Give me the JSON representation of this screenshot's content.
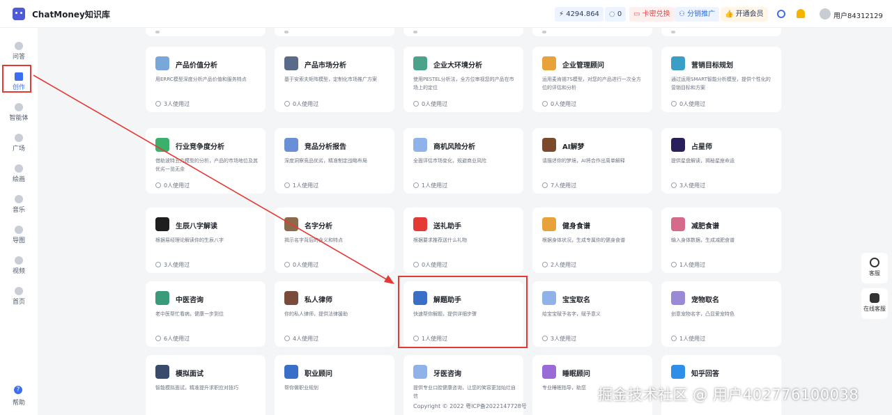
{
  "header": {
    "app_title": "ChatMoney知识库",
    "balance": "4294.864",
    "count": "0",
    "redeem_label": "卡密兑换",
    "promo_label": "分销推广",
    "vip_label": "开通会员",
    "user_name": "用户84312129"
  },
  "sidebar": {
    "items": [
      {
        "label": "问答",
        "icon": "chat-icon"
      },
      {
        "label": "创作",
        "icon": "pen-icon"
      },
      {
        "label": "智能体",
        "icon": "robot-icon"
      },
      {
        "label": "广场",
        "icon": "grid-icon"
      },
      {
        "label": "绘画",
        "icon": "palette-icon"
      },
      {
        "label": "音乐",
        "icon": "music-icon"
      },
      {
        "label": "导图",
        "icon": "mindmap-icon"
      },
      {
        "label": "视频",
        "icon": "video-icon"
      },
      {
        "label": "首页",
        "icon": "home-icon"
      }
    ],
    "help_label": "帮助"
  },
  "cards": [
    {
      "title": "产品价值分析",
      "desc": "用ERRC模型深度分析产品价值和服务特点",
      "usage": "3人使用过",
      "color": "#7aa7d9"
    },
    {
      "title": "产品市场分析",
      "desc": "基于安索夫矩阵模型，定制化市场推广方案",
      "usage": "0人使用过",
      "color": "#5a6b8a"
    },
    {
      "title": "企业大环境分析",
      "desc": "使用PESTEL分析法，全方位审视您的产品在市场上的定位",
      "usage": "0人使用过",
      "color": "#4aa38a"
    },
    {
      "title": "企业管理顾问",
      "desc": "运用麦肯锡7S模型，对您的产品进行一次全方位的评估和分析",
      "usage": "0人使用过",
      "color": "#e8a23a"
    },
    {
      "title": "营销目标规划",
      "desc": "通过运用SMART智能分析模型，提供个性化的营销目标和方案",
      "usage": "0人使用过",
      "color": "#3a9fc7"
    },
    {
      "title": "行业竞争度分析",
      "desc": "借助波特五力模型的分析，产品的市场地位及其优劣一览无余",
      "usage": "0人使用过",
      "color": "#3ab06a"
    },
    {
      "title": "竞品分析报告",
      "desc": "深度洞察竞品优劣，精准制定战略布局",
      "usage": "1人使用过",
      "color": "#6b8fd6"
    },
    {
      "title": "商机风险分析",
      "desc": "全面评估市场变化，规避商业风险",
      "usage": "1人使用过",
      "color": "#8fb3e8"
    },
    {
      "title": "AI解梦",
      "desc": "请描述你的梦境，AI将合作出周单解释",
      "usage": "7人使用过",
      "color": "#7a4a2a"
    },
    {
      "title": "占星师",
      "desc": "提供星盘解读，揭秘星座命运",
      "usage": "3人使用过",
      "color": "#2a1f5a"
    },
    {
      "title": "生辰八字解读",
      "desc": "根据易经理论解读你的生辰八字",
      "usage": "3人使用过",
      "color": "#1f1f1f"
    },
    {
      "title": "名字分析",
      "desc": "揭示名字背后的含义和特点",
      "usage": "0人使用过",
      "color": "#8a6a4a"
    },
    {
      "title": "送礼助手",
      "desc": "根据要求推荐送什么礼物",
      "usage": "0人使用过",
      "color": "#e53935"
    },
    {
      "title": "健身食谱",
      "desc": "根据身体状况，生成专属你的健身食谱",
      "usage": "2人使用过",
      "color": "#e8a23a"
    },
    {
      "title": "减肥食谱",
      "desc": "输入身体数据，生成减肥食谱",
      "usage": "1人使用过",
      "color": "#d66a8a"
    },
    {
      "title": "中医咨询",
      "desc": "老中医帮忙看病，健康一步到位",
      "usage": "6人使用过",
      "color": "#3a9a7a"
    },
    {
      "title": "私人律师",
      "desc": "你的私人律师，提供法律援助",
      "usage": "4人使用过",
      "color": "#7a4a3a"
    },
    {
      "title": "解题助手",
      "desc": "快速帮你解题，提供详细步骤",
      "usage": "1人使用过",
      "color": "#3a6fc7"
    },
    {
      "title": "宝宝取名",
      "desc": "给宝宝赋予名字，赋予意义",
      "usage": "3人使用过",
      "color": "#8fb3e8"
    },
    {
      "title": "宠物取名",
      "desc": "创意宠物名字，凸显爱宠特色",
      "usage": "1人使用过",
      "color": "#9a8ad6"
    },
    {
      "title": "模拟面试",
      "desc": "智能模拟面试，精准提升求职应对技巧",
      "usage": "",
      "color": "#3a4a6a"
    },
    {
      "title": "职业顾问",
      "desc": "帮你做职业规划",
      "usage": "",
      "color": "#3a6fc7"
    },
    {
      "title": "牙医咨询",
      "desc": "提供专业口腔健康咨询，让您的笑容更加灿烂自信",
      "usage": "",
      "color": "#8fb3e8"
    },
    {
      "title": "睡眠顾问",
      "desc": "专业睡眠指导，助您",
      "usage": "",
      "color": "#9a6ad6"
    },
    {
      "title": "知乎回答",
      "desc": "",
      "usage": "",
      "color": "#2f8fe8"
    }
  ],
  "float_buttons": [
    {
      "label": "客服",
      "icon": "headset-icon"
    },
    {
      "label": "在线客服",
      "icon": "bot-icon"
    }
  ],
  "footer": {
    "copyright": "Copyright © 2022 粤ICP备2022147728号"
  },
  "watermark": "掘金技术社区 @ 用户402776100038",
  "colors": {
    "accent": "#3b6ff0",
    "highlight": "#e53935"
  }
}
